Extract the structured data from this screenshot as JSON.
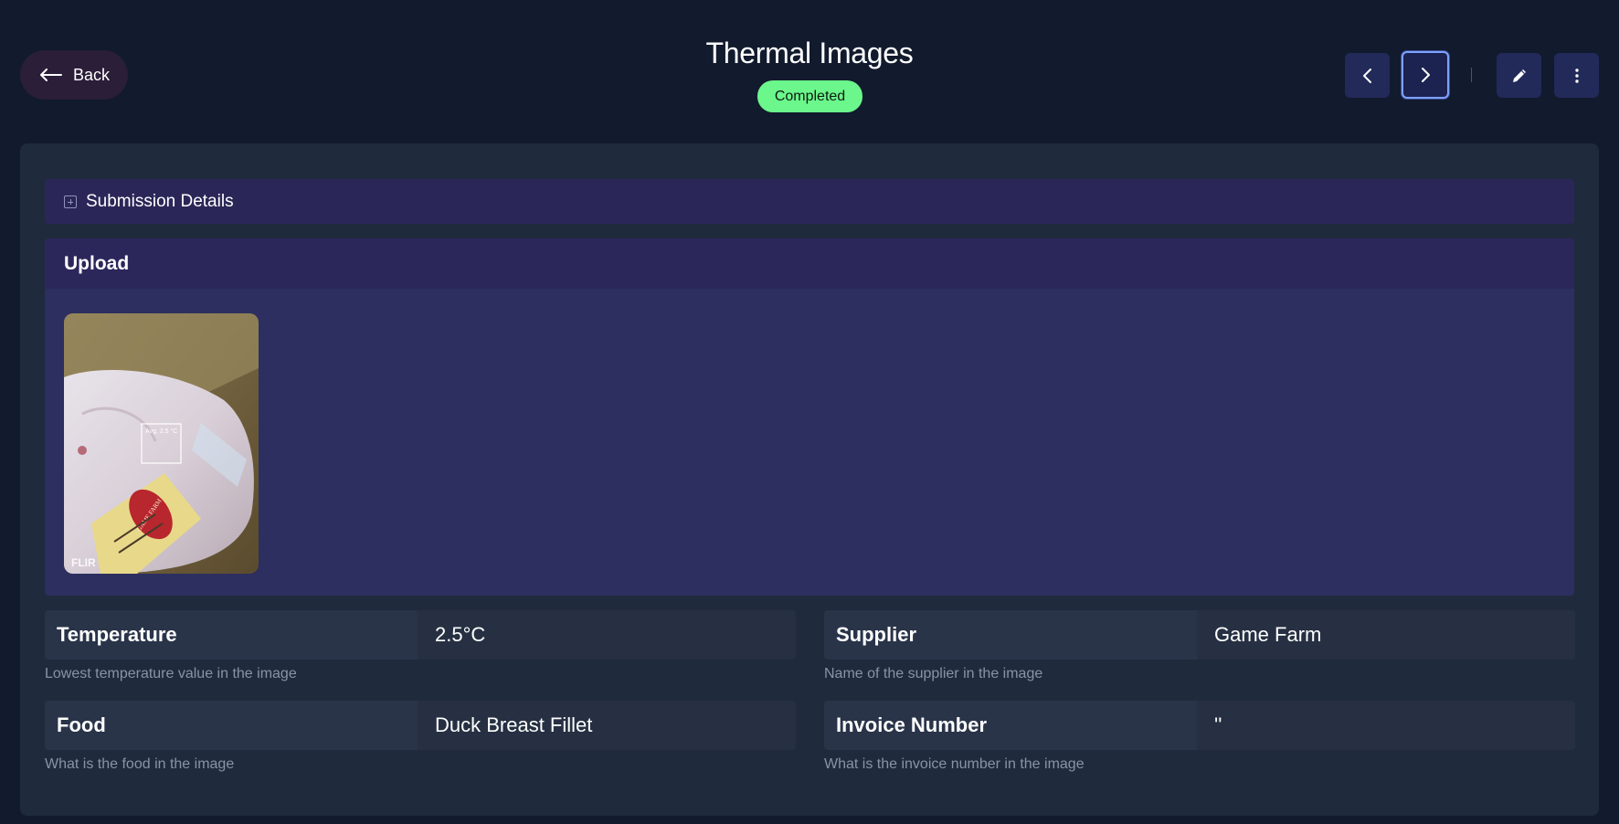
{
  "header": {
    "back_label": "Back",
    "title": "Thermal Images",
    "status": "Completed"
  },
  "sections": {
    "submission_details": "Submission Details",
    "upload_title": "Upload"
  },
  "image": {
    "overlay_label": "Avg. 2.5 °C",
    "brand": "FLIR",
    "package_label": "GAME FARM"
  },
  "fields": [
    {
      "label": "Temperature",
      "value": "2.5°C",
      "help": "Lowest temperature value in the image"
    },
    {
      "label": "Supplier",
      "value": "Game Farm",
      "help": "Name of the supplier in the image"
    },
    {
      "label": "Food",
      "value": "Duck Breast Fillet",
      "help": "What is the food in the image"
    },
    {
      "label": "Invoice Number",
      "value": "''",
      "help": "What is the invoice number in the image"
    }
  ],
  "colors": {
    "background": "#121a2e",
    "panel": "#202a3d",
    "status_badge": "#6bf78b",
    "accent": "#7ea2ff"
  },
  "icons": [
    "arrow-left-icon",
    "chevron-left-icon",
    "chevron-right-icon",
    "pencil-icon",
    "more-vertical-icon",
    "expand-plus-icon"
  ]
}
